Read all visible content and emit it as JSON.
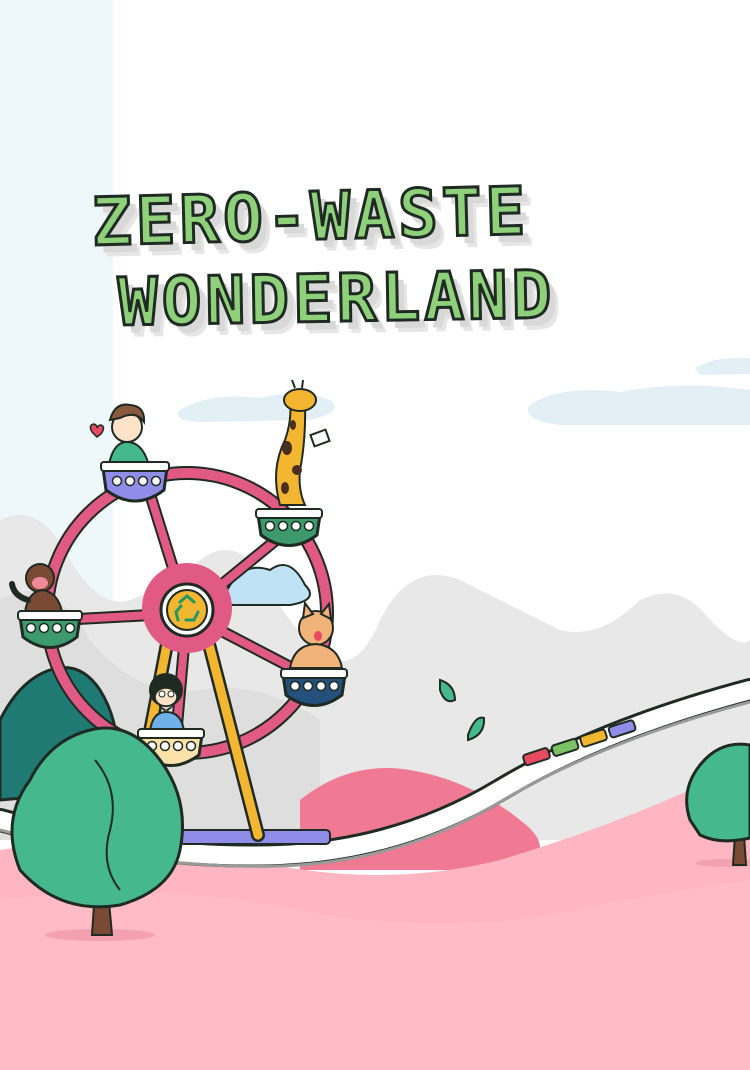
{
  "poster": {
    "title_line1": "ZERO-WASTE",
    "title_line2": "WONDERLAND"
  },
  "icons": {
    "recycle": "recycle-icon",
    "heart": "heart-icon",
    "leaf": "leaf-icon"
  },
  "colors": {
    "title_fill": "#8fd07a",
    "outline": "#1f2a22",
    "wheel_pink": "#e05a85",
    "ground_pink": "#ffb6c2",
    "tree_green": "#46b88e",
    "support_yellow": "#f2b631"
  }
}
